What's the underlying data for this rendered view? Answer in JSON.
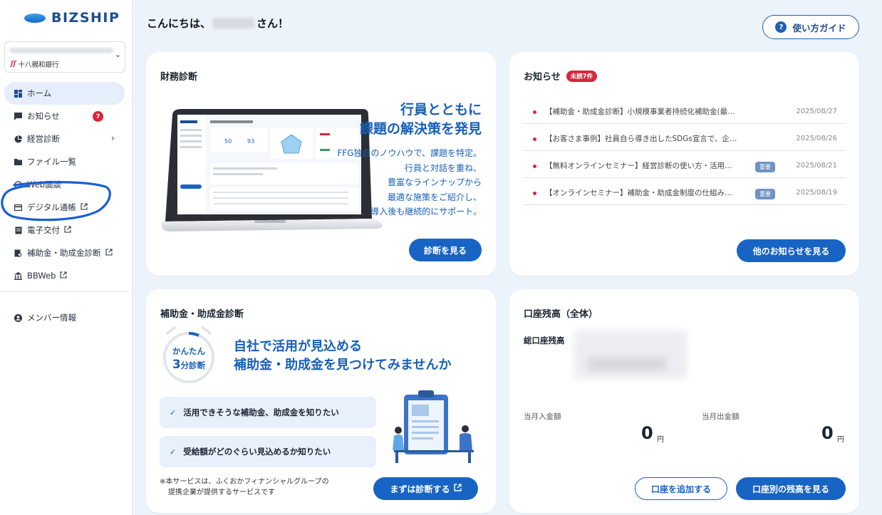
{
  "logo": {
    "text": "BIZSHIP"
  },
  "account": {
    "bank_name": "十八親和銀行"
  },
  "sidebar": {
    "items": [
      {
        "label": "ホーム"
      },
      {
        "label": "お知らせ",
        "badge": "7"
      },
      {
        "label": "経営診断"
      },
      {
        "label": "ファイル一覧"
      },
      {
        "label": "Web面談"
      },
      {
        "label": "デジタル通帳"
      },
      {
        "label": "電子交付"
      },
      {
        "label": "補助金・助成金診断"
      },
      {
        "label": "BBWeb"
      }
    ],
    "member": {
      "label": "メンバー情報"
    }
  },
  "header": {
    "greeting_prefix": "こんにちは、",
    "greeting_suffix": "さん！",
    "guide_label": "使い方ガイド"
  },
  "finance": {
    "title": "財務診断",
    "headline": [
      "行員とともに",
      "課題の解決策を発見"
    ],
    "body": [
      "FFG独自のノウハウで、課題を特定。",
      "行員と対話を重ね、",
      "豊富なラインナップから",
      "最適な施策をご紹介し、",
      "導入後も継続的にサポート。"
    ],
    "button": "診断を見る"
  },
  "news": {
    "title": "お知らせ",
    "unread": "未読7件",
    "items": [
      {
        "text": "【補助金・助成金診断】小規模事業者持続化補助金(最…",
        "date": "2025/08/27",
        "tag": ""
      },
      {
        "text": "【お客さま事例】社員自ら導き出したSDGs宣言で、企…",
        "date": "2025/08/26",
        "tag": ""
      },
      {
        "text": "【無料オンラインセミナー】経営診断の使い方・活用…",
        "date": "2025/08/21",
        "tag": "重要"
      },
      {
        "text": "【オンラインセミナー】補助金・助成金制度の仕組み…",
        "date": "2025/08/19",
        "tag": "重要"
      }
    ],
    "button": "他のお知らせを見る"
  },
  "subsidy": {
    "title": "補助金・助成金診断",
    "clock_line1": "かんたん",
    "clock_num": "3",
    "clock_line2": "分診断",
    "headline": [
      "自社で活用が見込める",
      "補助金・助成金を見つけてみませんか"
    ],
    "checks": [
      "活用できそうな補助金、助成金を知りたい",
      "受給額がどのぐらい見込めるか知りたい"
    ],
    "note": [
      "※本サービスは、ふくおかフィナンシャルグループの",
      "提携企業が提供するサービスです"
    ],
    "button": "まずは診断する"
  },
  "balance": {
    "title": "口座残高（全体）",
    "total_label": "総口座残高",
    "income_label": "当月入金額",
    "income_value": "0",
    "expense_label": "当月出金額",
    "expense_value": "0",
    "unit": "円",
    "add_button": "口座を追加する",
    "detail_button": "口座別の残高を見る"
  },
  "colors": {
    "accent": "#1864c4",
    "badge": "#d7263d",
    "annotation": "#1a5fd1"
  }
}
